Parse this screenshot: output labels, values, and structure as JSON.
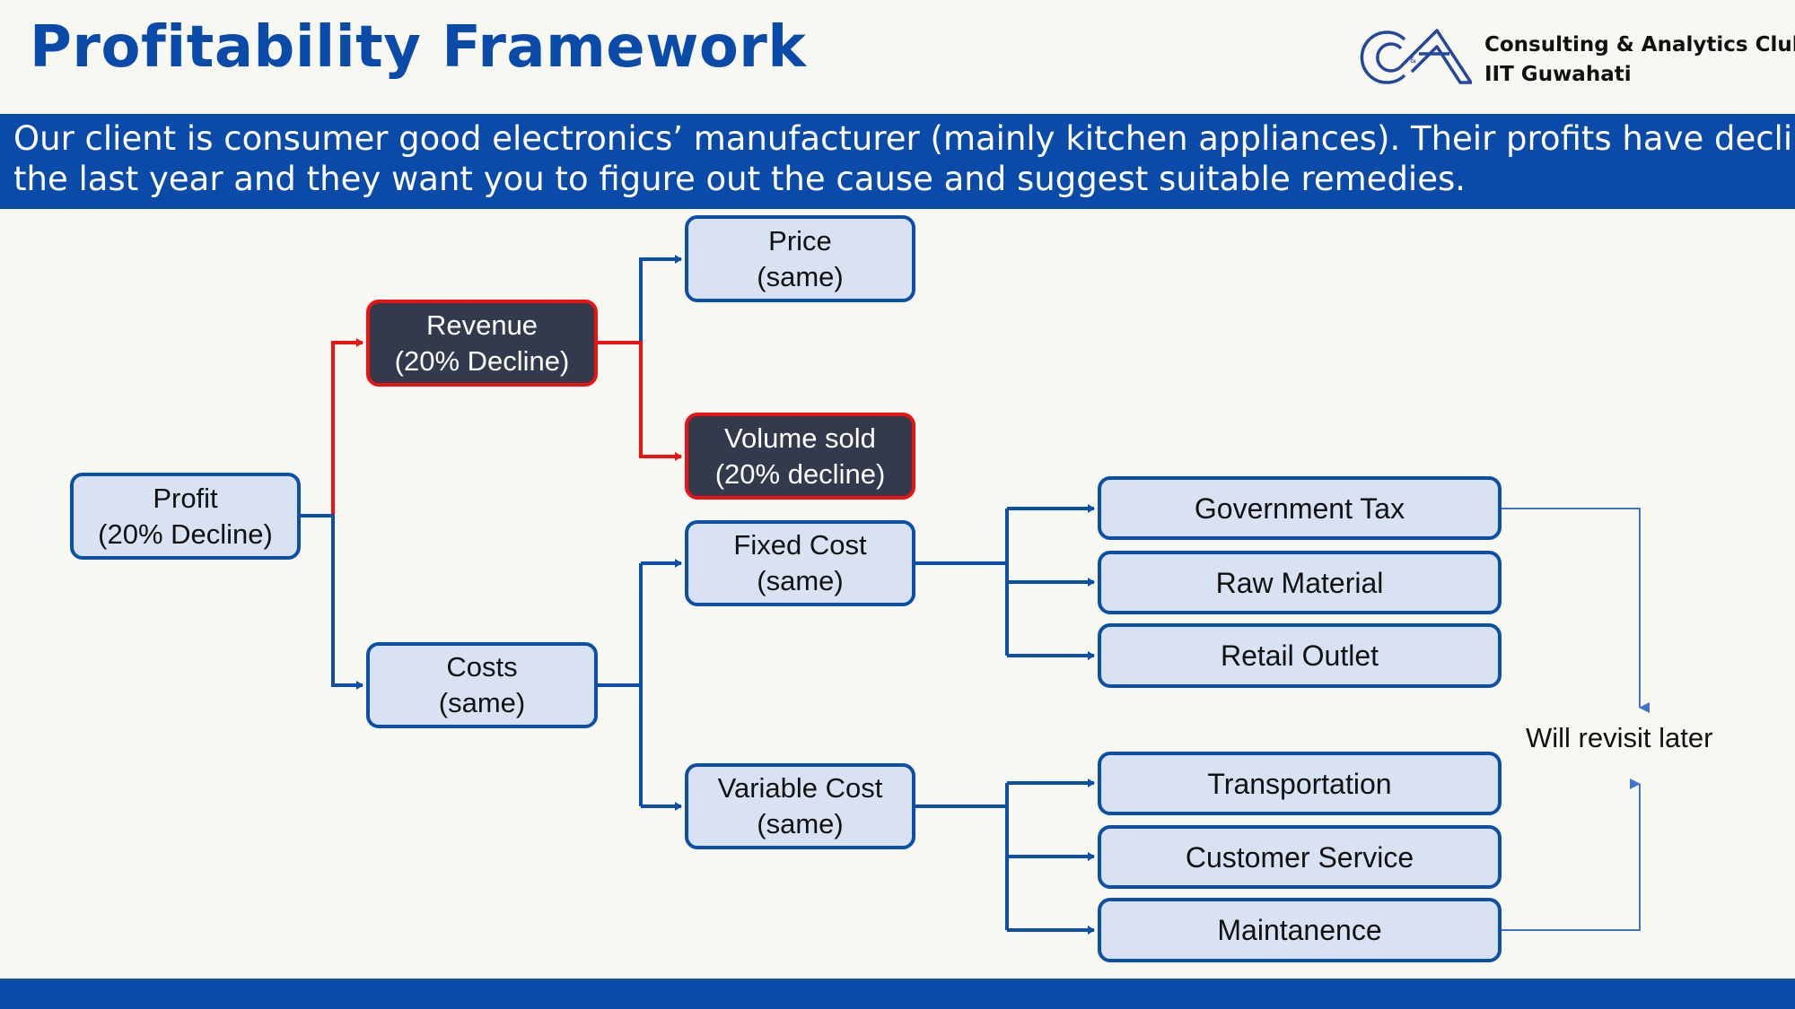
{
  "header": {
    "title": "Profitability Framework",
    "club_name": "Consulting & Analytics Club",
    "club_institute": "IIT Guwahati",
    "logo_icon": "ca-club-logo-icon"
  },
  "banner": {
    "line1": "Our client is consumer good electronics’ manufacturer (mainly kitchen appliances). Their profits have declined in",
    "line2": "the last year and they want you to figure out the cause and suggest suitable remedies."
  },
  "colors": {
    "brand_blue": "#0a4aa8",
    "node_fill": "#d8e2f3",
    "highlight_fill": "#333a4e",
    "highlight_border": "#ee1111",
    "note_arrow": "#4472c4"
  },
  "tree": {
    "profit": {
      "label": "Profit",
      "status": "(20% Decline)"
    },
    "revenue": {
      "label": "Revenue",
      "status": "(20% Decline)"
    },
    "costs": {
      "label": "Costs",
      "status": "(same)"
    },
    "price": {
      "label": "Price",
      "status": "(same)"
    },
    "volume": {
      "label": "Volume sold",
      "status": "(20% decline)"
    },
    "fixed_cost": {
      "label": "Fixed Cost",
      "status": "(same)"
    },
    "variable_cost": {
      "label": "Variable Cost",
      "status": "(same)"
    },
    "fixed_items": [
      "Government Tax",
      "Raw Material",
      "Retail Outlet"
    ],
    "variable_items": [
      "Transportation",
      "Customer Service",
      "Maintanence"
    ]
  },
  "note": "Will revisit later"
}
